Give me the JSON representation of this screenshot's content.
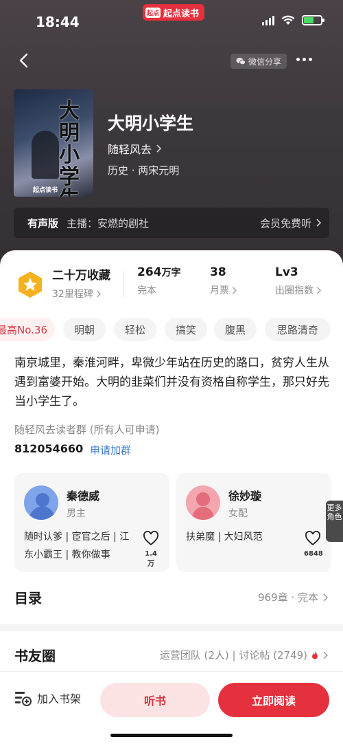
{
  "status_bar": {
    "time": "18:44",
    "app_name": "起点读书",
    "app_logo": "起点"
  },
  "nav": {
    "share_label": "微信分享"
  },
  "book": {
    "cover_title": "大明小学生",
    "cover_brand": "起点读书",
    "title": "大明小学生",
    "author": "随轻风去",
    "genre": "历史 · 两宋元明"
  },
  "audio": {
    "tag": "有声版",
    "narrator": "主播：安燃的剧社",
    "free_label": "会员免费听"
  },
  "stats": [
    {
      "big": "二十万收藏",
      "sub": "32里程碑"
    },
    {
      "big": "264",
      "unit": "万字",
      "sub": "完本"
    },
    {
      "big": "38",
      "sub": "月票"
    },
    {
      "big": "Lv3",
      "sub": "出圈指数"
    }
  ],
  "tags": [
    "最高No.36",
    "明朝",
    "轻松",
    "搞笑",
    "腹黑",
    "思路清奇"
  ],
  "description": "南京城里，秦淮河畔，卑微少年站在历史的路口，贫穷人生从遇到富婆开始。大明的韭菜们并没有资格自称学生，那只好先当小学生了。",
  "reader_group": {
    "name": "随轻风去读者群 (所有人可申请)",
    "id": "812054660",
    "join_label": "申请加群"
  },
  "characters": [
    {
      "name": "秦德威",
      "role": "男主",
      "tags": "随时认爹 | 宦官之后 | 江东小霸王 | 教你做事",
      "likes": "1.4万"
    },
    {
      "name": "徐妙璇",
      "role": "女配",
      "tags": "扶弟魔 | 大妇风范",
      "likes": "6848"
    }
  ],
  "more_roles": "更多角色",
  "toc": {
    "title": "目录",
    "summary": "969章 · 完本"
  },
  "circle": {
    "title": "书友圈",
    "summary": "运营团队 (2人) | 讨论帖 (2749)"
  },
  "bottom": {
    "shelf_label": "加入书架",
    "listen_label": "听书",
    "read_label": "立即阅读"
  },
  "colors": {
    "accent": "#e5303d",
    "hero_bg": "#3d383c",
    "link": "#3a79c8"
  }
}
